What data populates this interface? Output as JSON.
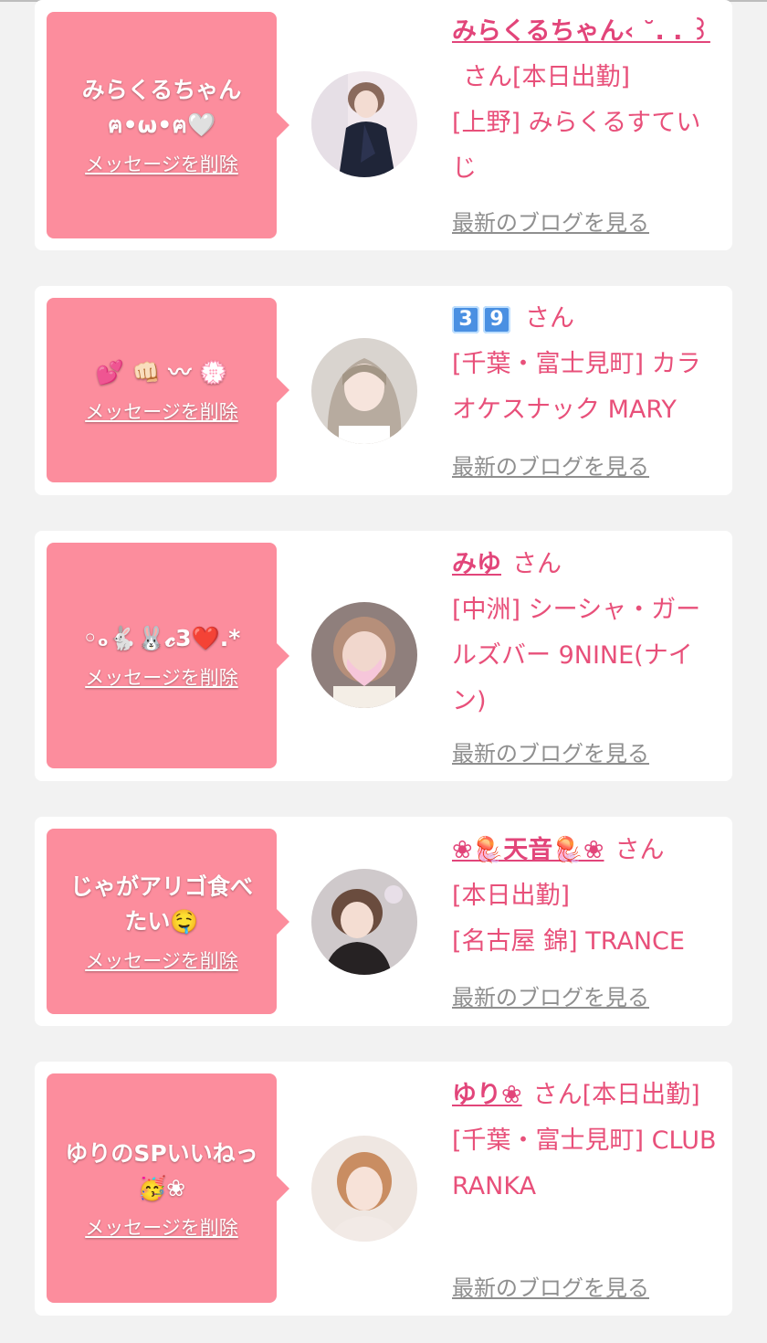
{
  "delete_label": "メッセージを削除",
  "blog_label": "最新のブログを見る",
  "san": "さん",
  "cards": [
    {
      "message": "みらくるちゃん\nฅ•ω•ฅ🤍",
      "name": "みらくるちゃん‹ ˘. . ꒱",
      "status": "[本日出勤]",
      "shop": "[上野] みらくるすていじ"
    },
    {
      "message": "💕 👊🏻 〰 💮",
      "name_digits": [
        "3",
        "9"
      ],
      "shop": "[千葉・富士見町] カラオケスナック MARY"
    },
    {
      "message": "◦ₒ🐇🐰𝓬3❤️.*",
      "name": "みゆ",
      "shop": "[中洲] シーシャ・ガールズバー 9NINE(ナイン)"
    },
    {
      "message": "じゃがアリゴ食べたい🤤",
      "name": "❀🪼天音🪼❀",
      "status": "[本日出勤]",
      "shop": "[名古屋 錦] TRANCE"
    },
    {
      "message": "ゆりのSPいいねっ🥳❀",
      "name": "ゆり❀",
      "status": "[本日出勤]",
      "shop": "[千葉・富士見町] CLUB RANKA"
    }
  ],
  "colors": {
    "bubble": "#fc8d9d",
    "accent": "#e8507a",
    "page_bg": "#f2f2f2",
    "link_gray": "#8f8f8f"
  }
}
